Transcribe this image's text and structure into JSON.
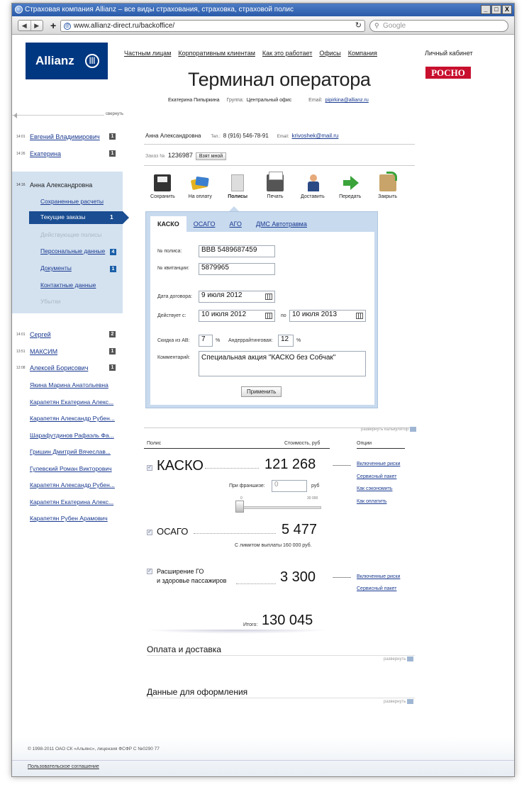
{
  "window": {
    "title": "Страховая компания Allianz – все виды страхования, страховка, страховой полис",
    "url": "www.allianz-direct.ru/backoffice/",
    "search_placeholder": "Google",
    "controls": [
      "_",
      "□",
      "X"
    ]
  },
  "header": {
    "logo_text": "Allianz",
    "nav": [
      "Частным лицам",
      "Корпоративным клиентам",
      "Как это работает",
      "Офисы",
      "Компания"
    ],
    "cabinet": "Личный кабинет",
    "partner_logo": "РОСНО",
    "page_title": "Терминал оператора",
    "operator_name": "Екатерина Пипыркина",
    "group_label": "Группа:",
    "group_value": "Центральный офис",
    "email_label": "Email:",
    "email_value": "pipirkina@allianz.ru"
  },
  "sidebar": {
    "collapse": "свернуть",
    "top_items": [
      {
        "time": "14:01",
        "name": "Евгений Владимирович",
        "badge": "1"
      },
      {
        "time": "14:26",
        "name": "Екатерина",
        "badge": "1"
      }
    ],
    "active": {
      "time": "14:16",
      "name": "Анна Александровна",
      "sub": [
        {
          "label": "Сохраненные расчеты",
          "badge": ""
        },
        {
          "label": "Текущие заказы",
          "badge": "1"
        },
        {
          "label": "Действующие полисы",
          "badge": ""
        },
        {
          "label": "Персональные данные",
          "badge": "4"
        },
        {
          "label": "Документы",
          "badge": "1"
        },
        {
          "label": "Контактные данные",
          "badge": ""
        },
        {
          "label": "Убытки",
          "badge": ""
        }
      ]
    },
    "bottom_items": [
      {
        "time": "14:01",
        "name": "Сергей",
        "badge": "2"
      },
      {
        "time": "13:51",
        "name": "МАКСИМ",
        "badge": "1"
      },
      {
        "time": "12:08",
        "name": "Алексей Борисович",
        "badge": "1"
      }
    ],
    "plain_items": [
      "Якина Марина Анатольевна",
      "Карапетян Екатерина Алекс...",
      "Карапетян Александр Рубен...",
      "Шарафутдинов Рафаэль Фа...",
      "Гришин Дмитрий Вячеслав...",
      "Гулевский Роман Викторович",
      "Карапетян Александр Рубен...",
      "Карапетян Екатерина Алекс...",
      "Карапетян Рубен Арамович"
    ]
  },
  "client": {
    "name": "Анна Александровна",
    "tel_label": "Тел.:",
    "tel": "8 (916) 546-78-91",
    "email_label": "Email:",
    "email": "krivoshek@mail.ru",
    "order_label": "Заказ №",
    "order_no": "1236987",
    "take_button": "Взят мной"
  },
  "actions": [
    "Сохранить",
    "На оплату",
    "Полисы",
    "Печать",
    "Доставить",
    "Передать",
    "Закрыть"
  ],
  "form": {
    "tabs": [
      "КАСКО",
      "ОСАГО",
      "АГО",
      "ДМС Автотравма"
    ],
    "policy_label": "№ полиса:",
    "policy_value": "ВВВ 5489687459",
    "receipt_label": "№ квитанции:",
    "receipt_value": "5879965",
    "contract_date_label": "Дата договора:",
    "contract_date": "9 июля 2012",
    "valid_label": "Действует с:",
    "valid_from": "10 июля 2012",
    "to_label": "по",
    "valid_to": "10 июля 2013",
    "discount_label": "Скидка из АВ:",
    "discount_value": "7",
    "percent": "%",
    "underwriting_label": "Андеррайтинговая:",
    "underwriting_value": "12",
    "comment_label": "Комментарий:",
    "comment_value": "Специальная акция \"КАСКО без Собчак\"",
    "apply_button": "Применить"
  },
  "calculator": {
    "expand_label": "развернуть калькулятор",
    "col_policy": "Полис",
    "col_cost": "Стоимость, руб",
    "col_options": "Опции",
    "kasko_name": "КАСКО",
    "kasko_price": "121 268",
    "franchise_label": "При франшизе:",
    "franchise_value": "0",
    "franchise_unit": "руб",
    "slider_min": "0",
    "slider_max": "30 000",
    "franchise_fraction": 0.0,
    "kasko_options": [
      "Включенные риски",
      "Сервисный пакет",
      "Как сэкономить",
      "Как оплатить"
    ],
    "osago_name": "ОСАГО",
    "osago_price": "5 477",
    "osago_note": "С лимитом выплаты 160 000 руб.",
    "ext_name_1": "Расширение ГО",
    "ext_name_2": "и здоровье пассажиров",
    "ext_price": "3 300",
    "ext_options": [
      "Включенные риски",
      "Сервисный пакет"
    ],
    "total_label": "Итого:",
    "total_value": "130 045"
  },
  "sections": {
    "payment_title": "Оплата и доставка",
    "data_title": "Данные для оформления",
    "expand": "развернуть"
  },
  "footer": {
    "copyright": "© 1998-2011 ОАО СК «Альянс», лицензия ФСФР С №0290 77",
    "agreement": "Пользовательское соглашение"
  },
  "colors": {
    "brand_blue": "#003781",
    "panel_blue": "#c8daee",
    "active_blue": "#1a4d91",
    "rosno_red": "#c8102e"
  }
}
